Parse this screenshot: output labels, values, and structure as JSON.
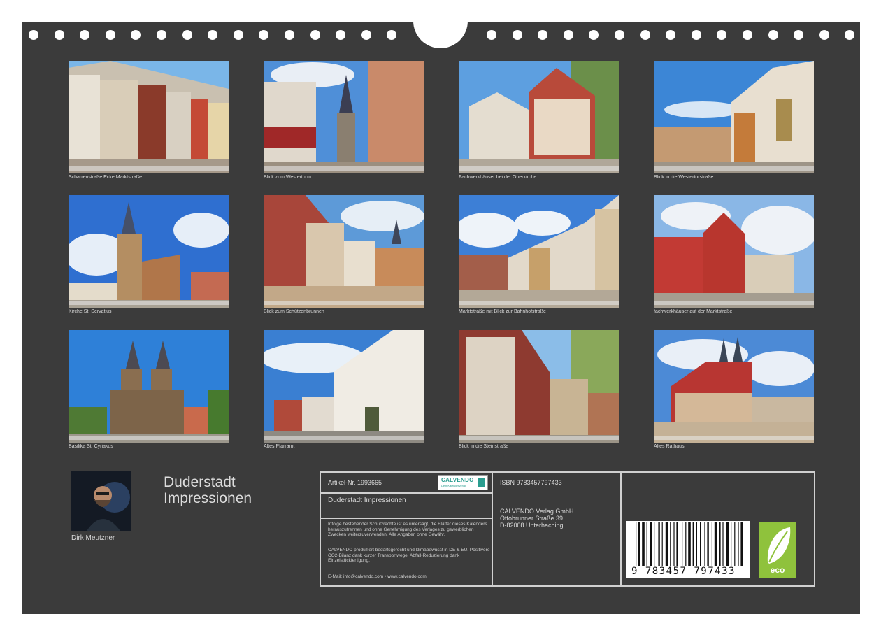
{
  "calendar": {
    "title_line1": "Duderstadt",
    "title_line2": "Impressionen",
    "author": "Dirk Meutzner"
  },
  "photos": [
    {
      "caption": "Scharrenstraße Ecke Marktstraße"
    },
    {
      "caption": "Blick zum Westerturm"
    },
    {
      "caption": "Fachwerkhäuser bei der Oberkirche"
    },
    {
      "caption": "Blick in die Westertorstraße"
    },
    {
      "caption": "Kirche St. Servatius"
    },
    {
      "caption": "Blick zum Schützenbrunnen"
    },
    {
      "caption": "Marktstraße mit Blick zur Bahnhofstraße"
    },
    {
      "caption": "fachwerkhäuser auf der Marktstraße"
    },
    {
      "caption": "Basilika St. Cyriakus"
    },
    {
      "caption": "Altes Pfarramt"
    },
    {
      "caption": "Blick in die Steinstraße"
    },
    {
      "caption": "Altes Rathaus"
    }
  ],
  "info": {
    "article_no": "Artikel-Nr. 1993665",
    "product_title": "Duderstadt Impressionen",
    "legal_text": "Infolge bestehender Schutzrechte ist es untersagt, die Blätter dieses Kalenders herauszutrennen und ohne Genehmigung des Verlages zu gewerblichen Zwecken weiterzuverwenden. Alle Angaben ohne Gewähr.",
    "eco_text": "CALVENDO produziert bedarfsgerecht und klimabewusst in DE & EU. Positivere CO2-Bilanz dank kurzer Transportwege. Abfall-Reduzierung dank Einzelstückfertigung.",
    "contact": "E-Mail: info@calvendo.com • www.calvendo.com",
    "isbn": "ISBN 9783457797433",
    "publisher_name": "CALVENDO Verlag GmbH",
    "publisher_street": "Ottobrunner Straße 39",
    "publisher_city": "D-82008 Unterhaching",
    "barcode_digits": "9 783457 797433",
    "logo_text": "CALVENDO",
    "logo_subtext": "Dein Kalenderverlag",
    "eco_label": "eco"
  },
  "colors": {
    "background": "#3b3b3b",
    "text": "#d8d8d8",
    "eco_green": "#8fc23c",
    "logo_teal": "#2a9d8f"
  }
}
